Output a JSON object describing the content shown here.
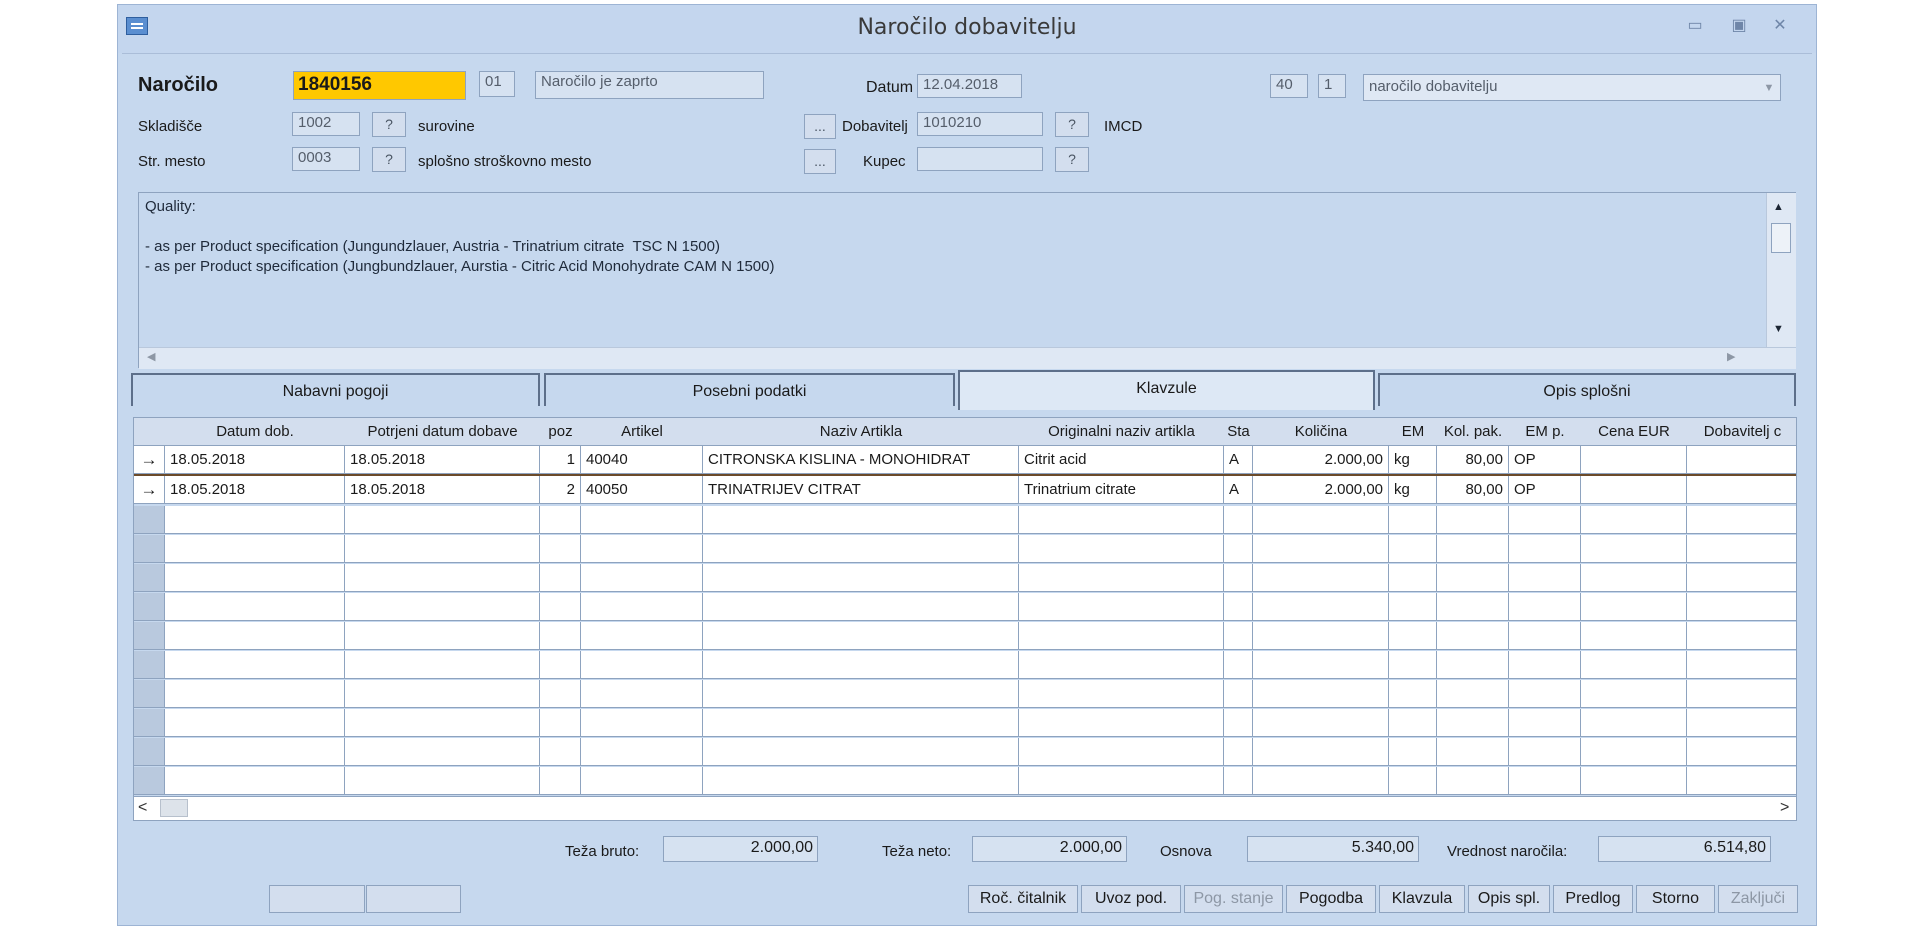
{
  "window": {
    "title": "Naročilo dobavitelju",
    "icon": "app-form-icon",
    "controls": [
      "minimize-icon",
      "maximize-icon",
      "close-icon"
    ]
  },
  "header": {
    "narocilo_label": "Naročilo",
    "narocilo_number": "1840156",
    "code": "01",
    "status": "Naročilo je zaprto",
    "datum_label": "Datum",
    "datum": "12.04.2018",
    "type_num": "40",
    "type_sub": "1",
    "type_select": "naročilo dobavitelju",
    "skladisce_label": "Skladišče",
    "skladisce": "1002",
    "skladisce_name": "surovine",
    "dobavitelj_label": "Dobavitelj",
    "dobavitelj": "1010210",
    "dobavitelj_name": "IMCD",
    "strmesto_label": "Str. mesto",
    "strmesto": "0003",
    "strmesto_name": "splošno stroškovno mesto",
    "kupec_label": "Kupec",
    "kupec": "",
    "q": "?",
    "dots": "..."
  },
  "memo": {
    "text": "Quality:\n\n- as per Product specification (Jungundzlauer, Austria - Trinatrium citrate  TSC N 1500)\n- as per Product specification (Jungbundzlauer, Aurstia - Citric Acid Monohydrate CAM N 1500)"
  },
  "tabs": [
    {
      "label": "Nabavni pogoji"
    },
    {
      "label": "Posebni podatki"
    },
    {
      "label": "Klavzule"
    },
    {
      "label": "Opis splošni"
    }
  ],
  "grid": {
    "columns": [
      "Datum dob.",
      "Potrjeni datum dobave",
      "poz",
      "Artikel",
      "Naziv Artikla",
      "Originalni naziv artikla",
      "Sta",
      "Količina",
      "EM",
      "Kol. pak.",
      "EM p.",
      "Cena EUR",
      "Dobavitelj c"
    ],
    "rows": [
      {
        "marker": "→",
        "datum": "18.05.2018",
        "potrjeni": "18.05.2018",
        "poz": "1",
        "artikel": "40040",
        "naziv": "CITRONSKA KISLINA - MONOHIDRAT",
        "original": "Citrit acid",
        "sta": "A",
        "kolicina": "2.000,00",
        "em": "kg",
        "kolpak": "80,00",
        "emp": "OP",
        "cena": "",
        "dob": ""
      },
      {
        "marker": "→",
        "datum": "18.05.2018",
        "potrjeni": "18.05.2018",
        "poz": "2",
        "artikel": "40050",
        "naziv": "TRINATRIJEV CITRAT",
        "original": "Trinatrium citrate",
        "sta": "A",
        "kolicina": "2.000,00",
        "em": "kg",
        "kolpak": "80,00",
        "emp": "OP",
        "cena": "",
        "dob": ""
      }
    ]
  },
  "totals": {
    "bruto_label": "Teža bruto:",
    "bruto": "2.000,00",
    "neto_label": "Teža neto:",
    "neto": "2.000,00",
    "osnova_label": "Osnova",
    "osnova": "5.340,00",
    "vrednost_label": "Vrednost naročila:",
    "vrednost": "6.514,80"
  },
  "buttons": {
    "roc": "Roč. čitalnik",
    "uvoz": "Uvoz pod.",
    "pog_stanje": "Pog. stanje",
    "pogodba": "Pogodba",
    "klavzula": "Klavzula",
    "opis": "Opis spl.",
    "predlog": "Predlog",
    "storno": "Storno",
    "zakljuci": "Zaključi"
  },
  "colors": {
    "highlight": "#ffc800",
    "window_bg": "#c6d8ee"
  }
}
